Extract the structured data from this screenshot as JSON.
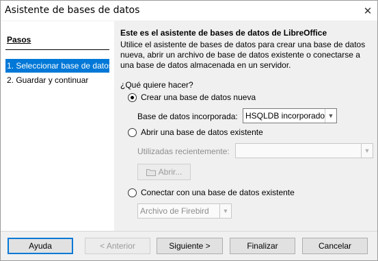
{
  "window": {
    "title": "Asistente de bases de datos",
    "close_symbol": "✕"
  },
  "sidebar": {
    "title": "Pasos",
    "steps": [
      {
        "label": "1. Seleccionar base de datos",
        "active": true
      },
      {
        "label": "2. Guardar y continuar",
        "active": false
      }
    ]
  },
  "main": {
    "heading": "Este es el asistente de bases de datos de LibreOffice",
    "intro": "Utilice el asistente de bases de datos para crear una base de datos nueva, abrir un archivo de base de datos existente o conectarse a una base de datos almacenada en un servidor.",
    "question": "¿Qué quiere hacer?",
    "options": {
      "create_new": {
        "label": "Crear una base de datos nueva",
        "checked": true
      },
      "embedded_label": "Base de datos incorporada:",
      "embedded_value": "HSQLDB incorporado",
      "open_existing": {
        "label": "Abrir una base de datos existente",
        "checked": false
      },
      "recent_label": "Utilizadas recientemente:",
      "recent_value": "",
      "open_button": "Abrir...",
      "connect_existing": {
        "label": "Conectar con una base de datos existente",
        "checked": false
      },
      "connect_value": "Archivo de Firebird"
    }
  },
  "footer": {
    "help": "Ayuda",
    "back": "< Anterior",
    "next": "Siguiente >",
    "finish": "Finalizar",
    "cancel": "Cancelar"
  },
  "colors": {
    "accent": "#0078d7",
    "panel": "#f0f0f0"
  }
}
